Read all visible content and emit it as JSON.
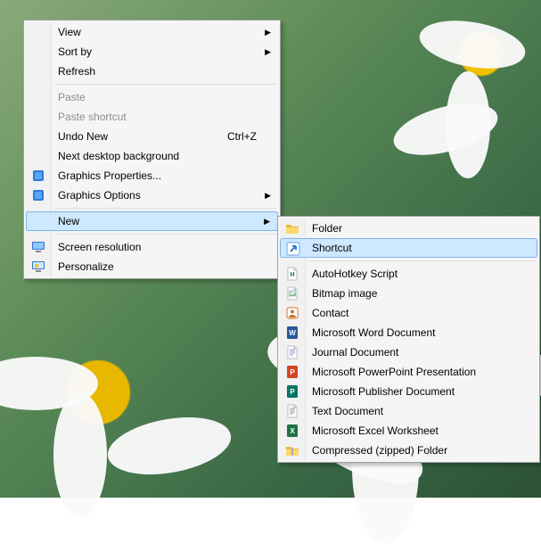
{
  "contextMenu": {
    "items": [
      {
        "key": "view",
        "label": "View",
        "submenu": true
      },
      {
        "key": "sortby",
        "label": "Sort by",
        "submenu": true
      },
      {
        "key": "refresh",
        "label": "Refresh"
      },
      {
        "sep": true
      },
      {
        "key": "paste",
        "label": "Paste",
        "disabled": true
      },
      {
        "key": "paste-shortcut",
        "label": "Paste shortcut",
        "disabled": true
      },
      {
        "key": "undo",
        "label": "Undo New",
        "accel": "Ctrl+Z"
      },
      {
        "key": "next-bg",
        "label": "Next desktop background"
      },
      {
        "key": "gfx-props",
        "label": "Graphics Properties...",
        "icon": "chip"
      },
      {
        "key": "gfx-opts",
        "label": "Graphics Options",
        "icon": "chip",
        "submenu": true
      },
      {
        "sep": true
      },
      {
        "key": "new",
        "label": "New",
        "submenu": true,
        "hover": true
      },
      {
        "sep": true
      },
      {
        "key": "screen-res",
        "label": "Screen resolution",
        "icon": "monitor"
      },
      {
        "key": "personalize",
        "label": "Personalize",
        "icon": "personalize"
      }
    ]
  },
  "newSubmenu": {
    "items": [
      {
        "key": "folder",
        "label": "Folder",
        "icon": "folder"
      },
      {
        "key": "shortcut",
        "label": "Shortcut",
        "icon": "shortcut",
        "hover": true
      },
      {
        "sep": true
      },
      {
        "key": "ahk",
        "label": "AutoHotkey Script",
        "icon": "ahk"
      },
      {
        "key": "bmp",
        "label": "Bitmap image",
        "icon": "bmp"
      },
      {
        "key": "contact",
        "label": "Contact",
        "icon": "contact"
      },
      {
        "key": "docx",
        "label": "Microsoft Word Document",
        "icon": "word"
      },
      {
        "key": "jnt",
        "label": "Journal Document",
        "icon": "journal"
      },
      {
        "key": "pptx",
        "label": "Microsoft PowerPoint Presentation",
        "icon": "ppt"
      },
      {
        "key": "pub",
        "label": "Microsoft Publisher Document",
        "icon": "pub"
      },
      {
        "key": "txt",
        "label": "Text Document",
        "icon": "txt"
      },
      {
        "key": "xlsx",
        "label": "Microsoft Excel Worksheet",
        "icon": "excel"
      },
      {
        "key": "zip",
        "label": "Compressed (zipped) Folder",
        "icon": "zip"
      }
    ]
  }
}
